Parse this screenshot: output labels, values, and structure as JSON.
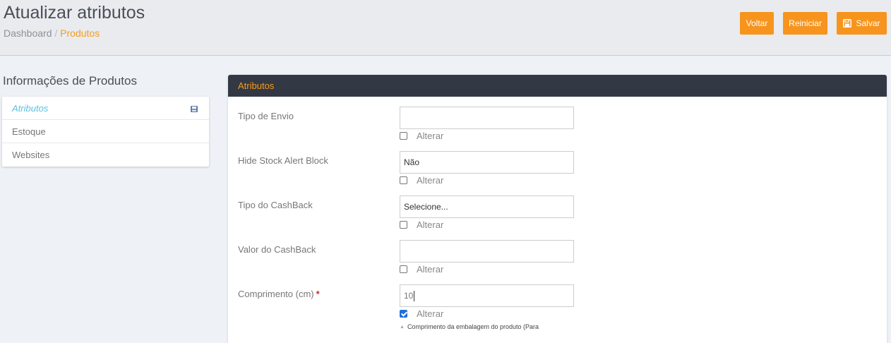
{
  "header": {
    "title": "Atualizar atributos",
    "breadcrumb": {
      "home": "Dashboard",
      "separator": "/",
      "current": "Produtos"
    },
    "buttons": {
      "back": "Voltar",
      "reset": "Reiniciar",
      "save": "Salvar"
    }
  },
  "sidebar": {
    "heading": "Informações de Produtos",
    "items": [
      {
        "label": "Atributos",
        "active": true
      },
      {
        "label": "Estoque",
        "active": false
      },
      {
        "label": "Websites",
        "active": false
      }
    ]
  },
  "panel": {
    "title": "Atributos",
    "change_label": "Alterar",
    "fields": [
      {
        "label": "Tipo de Envio",
        "value": "",
        "checked": false
      },
      {
        "label": "Hide Stock Alert Block",
        "value": "Não",
        "checked": false
      },
      {
        "label": "Tipo do CashBack",
        "value": "Selecione...",
        "checked": false
      },
      {
        "label": "Valor do CashBack",
        "value": "",
        "checked": false
      },
      {
        "label": "Comprimento (cm)",
        "required_mark": "*",
        "value": "10",
        "checked": true
      }
    ],
    "hint": "Comprimento da embalagem do produto (Para"
  },
  "colors": {
    "accent": "#f7941d",
    "panel_header_bg": "#333944",
    "active_link": "#5bc0de",
    "required": "#c9302c",
    "checkbox_checked": "#1e6fd9"
  },
  "icons": {
    "save_button": "floppy-disk-icon",
    "active_menu_item": "floppy-disk-icon",
    "hint": "triangle-up-icon"
  }
}
